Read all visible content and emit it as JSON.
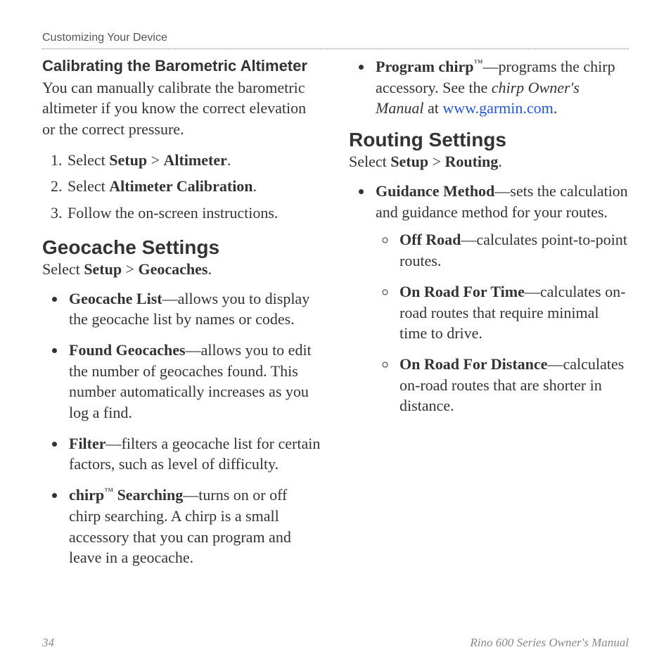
{
  "header": "Customizing Your Device",
  "section1": {
    "heading": "Calibrating the Barometric Altimeter",
    "intro": "You can manually calibrate the barometric altimeter if you know the correct elevation or the correct pressure.",
    "step1_pre": "Select ",
    "step1_b1": "Setup",
    "step1_mid": " > ",
    "step1_b2": "Altimeter",
    "step1_post": ".",
    "step2_pre": "Select ",
    "step2_b": "Altimeter Calibration",
    "step2_post": ".",
    "step3": "Follow the on-screen instructions."
  },
  "geocache": {
    "heading": "Geocache Settings",
    "select_pre": "Select ",
    "select_b1": "Setup",
    "select_mid": " > ",
    "select_b2": "Geocaches",
    "select_post": ".",
    "items": [
      {
        "term": "Geocache List",
        "desc": "—allows you to display the geocache list by names or codes."
      },
      {
        "term": "Found Geocaches",
        "desc": "—allows you to edit the number of geocaches found. This number automatically increases as you log a find."
      },
      {
        "term": "Filter",
        "desc": "—filters a geocache list for certain factors, such as level of difficulty."
      }
    ],
    "chirp_search_term": "chirp",
    "chirp_search_term2": " Searching",
    "chirp_search_desc": "—turns on or off chirp searching. A chirp is a small accessory that you can program and leave in a geocache.",
    "prog_chirp_term": "Program chirp",
    "prog_chirp_desc1": "—programs the chirp accessory. See the ",
    "prog_chirp_italic": "chirp Owner's Manual",
    "prog_chirp_desc2": " at ",
    "prog_chirp_link": "www.garmin.com",
    "prog_chirp_desc3": "."
  },
  "routing": {
    "heading": "Routing Settings",
    "select_pre": "Select ",
    "select_b1": "Setup",
    "select_mid": " > ",
    "select_b2": "Routing",
    "select_post": ".",
    "guidance_term": "Guidance Method",
    "guidance_desc": "—sets the calculation and guidance method for your routes.",
    "sub": [
      {
        "term": "Off Road",
        "desc": "—calculates point-to-point routes."
      },
      {
        "term": "On Road For Time",
        "desc": "—calculates on-road routes that require minimal time to drive."
      },
      {
        "term": "On Road For Distance",
        "desc": "—calculates on-road routes that are shorter in distance."
      }
    ]
  },
  "footer": {
    "page": "34",
    "manual": "Rino 600 Series Owner's Manual"
  },
  "tm": "™"
}
